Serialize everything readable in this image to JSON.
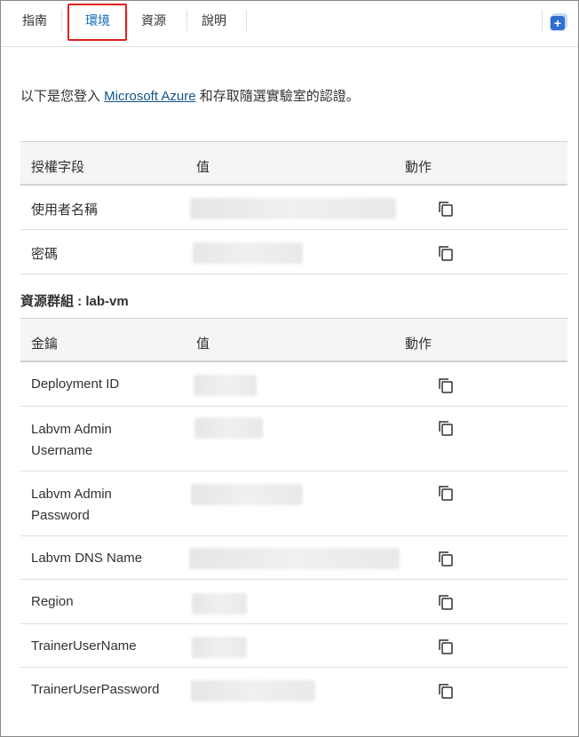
{
  "tabs": [
    {
      "label": "指南",
      "active": false
    },
    {
      "label": "環境",
      "active": true
    },
    {
      "label": "資源",
      "active": false
    },
    {
      "label": "說明",
      "active": false
    }
  ],
  "intro": {
    "prefix": "以下是您登入 ",
    "link": "Microsoft Azure",
    "suffix": " 和存取隨選實驗室的認證。"
  },
  "credentials_table": {
    "headers": [
      "授權字段",
      "值",
      "動作"
    ],
    "rows": [
      {
        "name": "使用者名稱",
        "value": ""
      },
      {
        "name": "密碼",
        "value": ""
      }
    ]
  },
  "resource_group": {
    "title": "資源群組 : lab-vm"
  },
  "keys_table": {
    "headers": [
      "金鑰",
      "值",
      "動作"
    ],
    "rows": [
      {
        "name": "Deployment ID"
      },
      {
        "name": "Labvm Admin Username"
      },
      {
        "name": "Labvm Admin Password"
      },
      {
        "name": "Labvm DNS Name"
      },
      {
        "name": "Region"
      },
      {
        "name": "TrainerUserName"
      },
      {
        "name": "TrainerUserPassword"
      }
    ]
  },
  "icons": {
    "copy": "copy-icon",
    "corner": "add-panel-icon"
  },
  "colors": {
    "active_tab": "#0f6cbd",
    "link": "#0f548c",
    "highlight": "#e02020"
  }
}
